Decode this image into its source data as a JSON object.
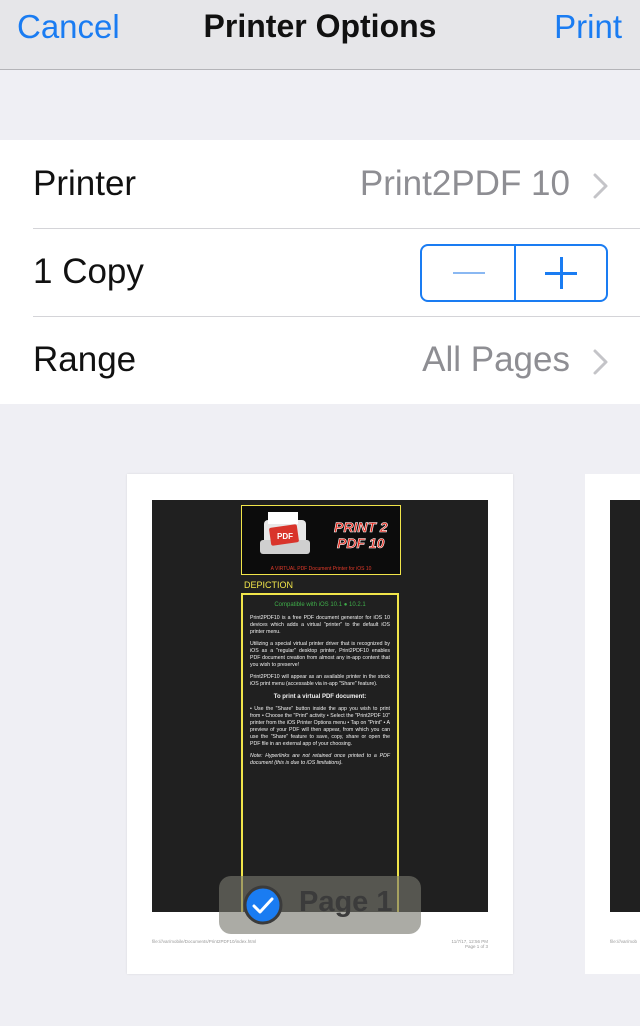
{
  "nav": {
    "cancel_label": "Cancel",
    "title": "Printer Options",
    "print_label": "Print"
  },
  "options": {
    "printer_label": "Printer",
    "printer_value": "Print2PDF 10",
    "copies_label": "1 Copy",
    "range_label": "Range",
    "range_value": "All Pages"
  },
  "preview": {
    "logo_text_line1": "PRINT 2",
    "logo_text_line2": "PDF 10",
    "logo_icon_text": "PDF",
    "banner_tag": "A VIRTUAL PDF Document Printer for iOS 10",
    "depiction_label": "DEPICTION",
    "compat_text": "Compatible with iOS 10.1 ● 10.2.1",
    "para1": "Print2PDF10 is a free PDF document generator for iOS 10 devices which adds a virtual \"printer\" to the default iOS printer menu.",
    "para2": "Utilizing a special virtual printer driver that is recognized by iOS as a \"regular\" desktop printer, Print2PDF10 enables PDF document creation from almost any in-app content that you wish to preserve!",
    "para3": "Print2PDF10 will appear as an available printer in the stock iOS print menu (accessable via in-app \"Share\" feature).",
    "heading": "To print a virtual PDF document:",
    "steps": "• Use the \"Share\" button inside the app you wish to print from • Choose the \"Print\" activity • Select the \"Print2PDF 10\" printer from the iOS Printer Options menu • Tap on \"Print\" • A preview of your PDF will then appear, from which you can use the \"Share\" feature to save, copy, share or open the PDF file in an external app of your choosing.",
    "note": "Note: Hyperlinks are not retained once printed to a PDF document (this is due to iOS limitations).",
    "footer_left": "file:///var/mobile/Documents/Print2PDF10/index.html",
    "footer_right_1": "11/7/17, 12:56 PM",
    "footer_right_2": "Page 1 of 3",
    "footer_page2": "file:///var/mob",
    "page_badge_label": "Page 1"
  },
  "colors": {
    "accent": "#1a7cf2",
    "nav_bg": "#e6e6e9",
    "page_bg": "#efeff4",
    "doc_bg": "#202020",
    "highlight": "#f1e54a",
    "compat_green": "#3fae4a"
  },
  "icons": [
    "chevron-right-icon",
    "minus-icon",
    "plus-icon",
    "checkmark-circle-icon",
    "printer-logo-icon"
  ]
}
